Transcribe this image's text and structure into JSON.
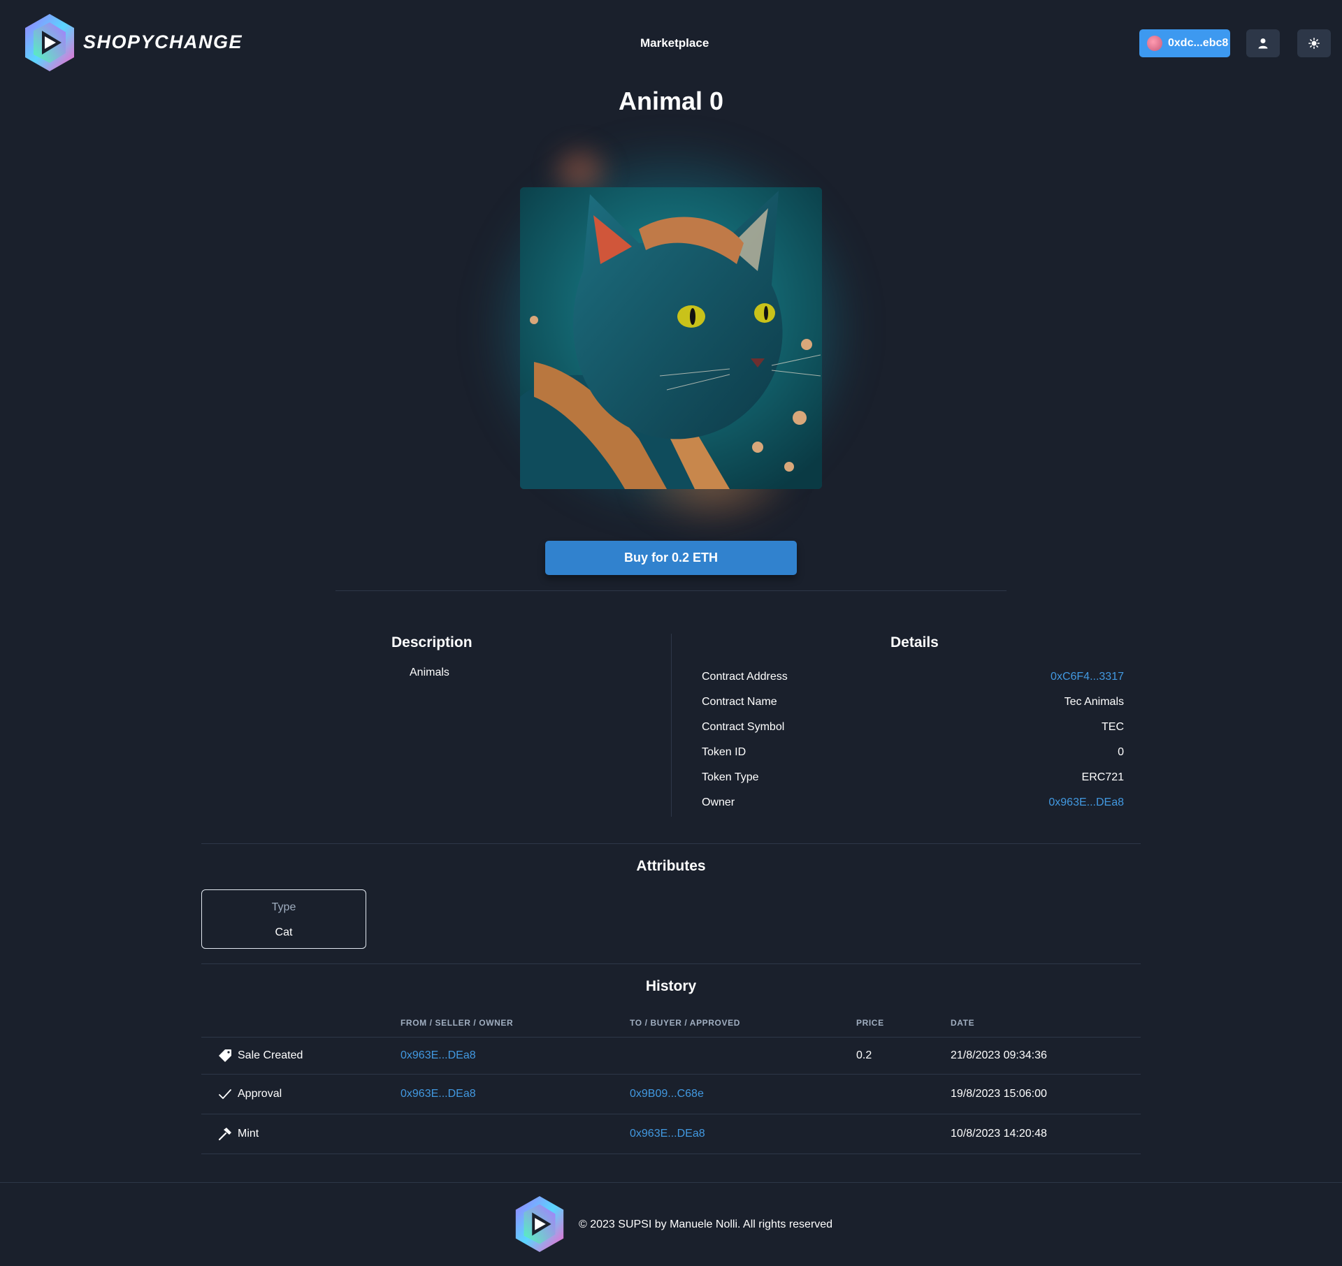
{
  "header": {
    "brand": "SHOPYCHANGE",
    "nav_marketplace": "Marketplace",
    "wallet_address": "0xdc...ebc8"
  },
  "nft": {
    "title": "Animal 0",
    "buy_label": "Buy for 0.2 ETH"
  },
  "description": {
    "heading": "Description",
    "text": "Animals"
  },
  "details": {
    "heading": "Details",
    "rows": [
      {
        "label": "Contract Address",
        "value": "0xC6F4...3317"
      },
      {
        "label": "Contract Name",
        "value": "Tec Animals"
      },
      {
        "label": "Contract Symbol",
        "value": "TEC"
      },
      {
        "label": "Token ID",
        "value": "0"
      },
      {
        "label": "Token Type",
        "value": "ERC721"
      },
      {
        "label": "Owner",
        "value": "0x963E...DEa8"
      }
    ]
  },
  "attributes": {
    "heading": "Attributes",
    "items": [
      {
        "type": "Type",
        "value": "Cat"
      }
    ]
  },
  "history": {
    "heading": "History",
    "columns": [
      "",
      "FROM / SELLER / OWNER",
      "TO / BUYER / APPROVED",
      "PRICE",
      "DATE"
    ],
    "rows": [
      {
        "event": "Sale Created",
        "icon": "tag-icon",
        "from": "0x963E...DEa8",
        "to": "",
        "price": "0.2",
        "date": "21/8/2023 09:34:36"
      },
      {
        "event": "Approval",
        "icon": "check-icon",
        "from": "0x963E...DEa8",
        "to": "0x9B09...C68e",
        "price": "",
        "date": "19/8/2023 15:06:00"
      },
      {
        "event": "Mint",
        "icon": "hammer-icon",
        "from": "",
        "to": "0x963E...DEa8",
        "price": "",
        "date": "10/8/2023 14:20:48"
      }
    ]
  },
  "footer": {
    "text": "© 2023 SUPSI by Manuele Nolli. All rights reserved"
  },
  "colors": {
    "background": "#1a202c",
    "accent": "#3182ce",
    "link": "#4299e1"
  }
}
